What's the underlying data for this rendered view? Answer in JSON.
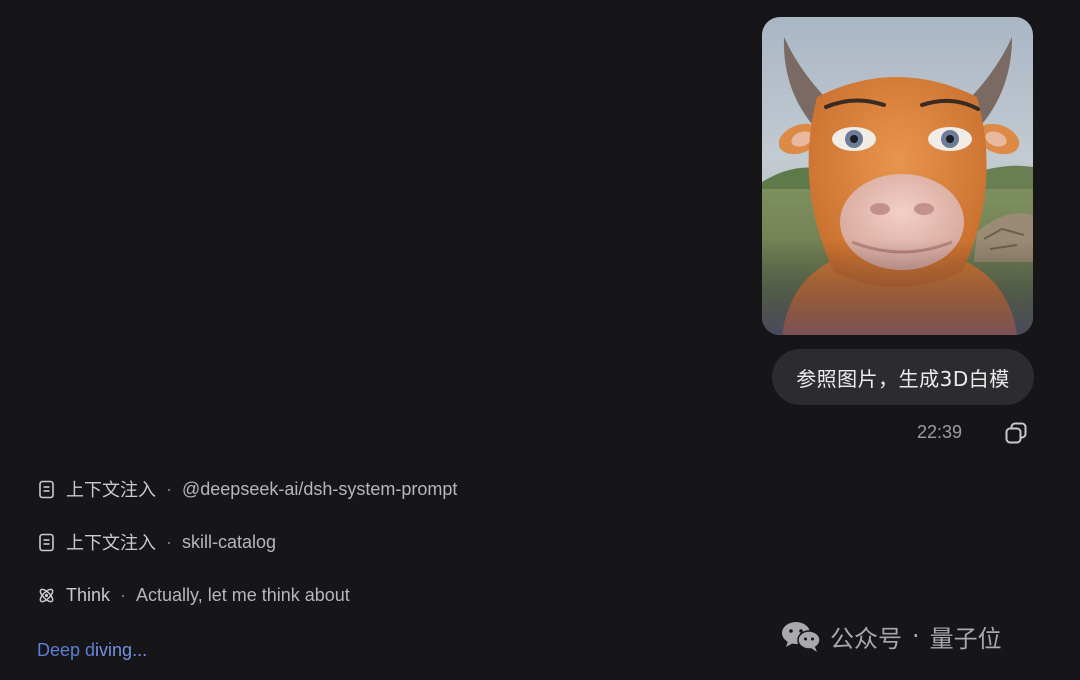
{
  "message": {
    "prompt_text": "参照图片，生成3D白模",
    "time": "22:39"
  },
  "steps": [
    {
      "label": "上下文注入",
      "detail": "@deepseek-ai/dsh-system-prompt",
      "icon": "document-icon"
    },
    {
      "label": "上下文注入",
      "detail": "skill-catalog",
      "icon": "document-icon"
    },
    {
      "label": "Think",
      "detail": "Actually, let me think about",
      "icon": "atom-icon"
    }
  ],
  "separator": "·",
  "status": {
    "part1": "Deep d",
    "part2": "iving..."
  },
  "watermark": {
    "brand": "公众号",
    "dot": "·",
    "name": "量子位",
    "icon": "wechat-icon"
  },
  "colors": {
    "background": "#161618",
    "bubble": "#2c2c2f",
    "accent": "#5b7fd6"
  }
}
